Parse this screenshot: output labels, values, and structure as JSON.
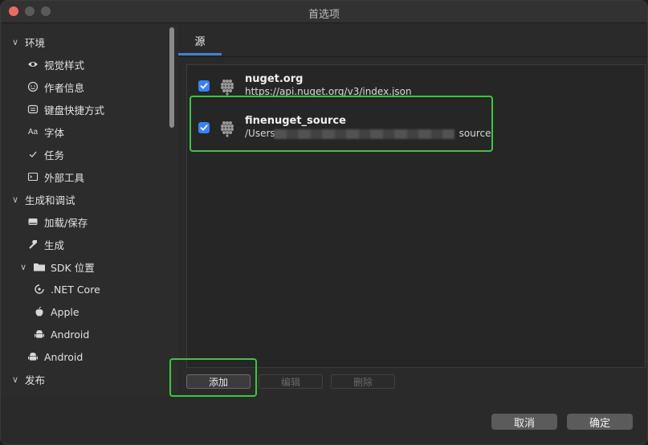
{
  "window": {
    "title": "首选项"
  },
  "sidebar": {
    "items": [
      {
        "label": "环境",
        "level": 0,
        "chevron": "down",
        "icon": ""
      },
      {
        "label": "视觉样式",
        "level": 1,
        "icon": "eye-icon"
      },
      {
        "label": "作者信息",
        "level": 1,
        "icon": "smiley-icon"
      },
      {
        "label": "键盘快捷方式",
        "level": 1,
        "icon": "keyboard-icon"
      },
      {
        "label": "字体",
        "level": 1,
        "icon": "font-icon"
      },
      {
        "label": "任务",
        "level": 1,
        "icon": "checkmark-icon"
      },
      {
        "label": "外部工具",
        "level": 1,
        "icon": "terminal-icon"
      },
      {
        "label": "生成和调试",
        "level": 0,
        "chevron": "down",
        "icon": ""
      },
      {
        "label": "加载/保存",
        "level": 1,
        "icon": "drive-icon"
      },
      {
        "label": "生成",
        "level": 1,
        "icon": "hammer-icon"
      },
      {
        "label": "SDK 位置",
        "level": 1,
        "chevron": "down",
        "icon": "folder-icon"
      },
      {
        "label": ".NET Core",
        "level": 2,
        "icon": "dotnet-icon"
      },
      {
        "label": "Apple",
        "level": 2,
        "icon": "apple-icon"
      },
      {
        "label": "Android",
        "level": 2,
        "icon": "android-icon"
      },
      {
        "label": "Android",
        "level": 1,
        "icon": "android-icon"
      },
      {
        "label": "发布",
        "level": 0,
        "chevron": "down",
        "icon": ""
      }
    ]
  },
  "tabs": [
    {
      "label": "源",
      "active": true
    }
  ],
  "sources": [
    {
      "name": "nuget.org",
      "url": "https://api.nuget.org/v3/index.json",
      "checked": true
    },
    {
      "name": "finenuget_source",
      "url": "/Users",
      "url_suffix": "source",
      "checked": true,
      "redacted": true
    }
  ],
  "buttons": {
    "add": "添加",
    "edit": "编辑",
    "delete": "删除"
  },
  "footer": {
    "cancel": "取消",
    "ok": "确定"
  },
  "colors": {
    "accent": "#3b82d6",
    "highlight": "#3fc53f",
    "close": "#ed6a5e"
  }
}
